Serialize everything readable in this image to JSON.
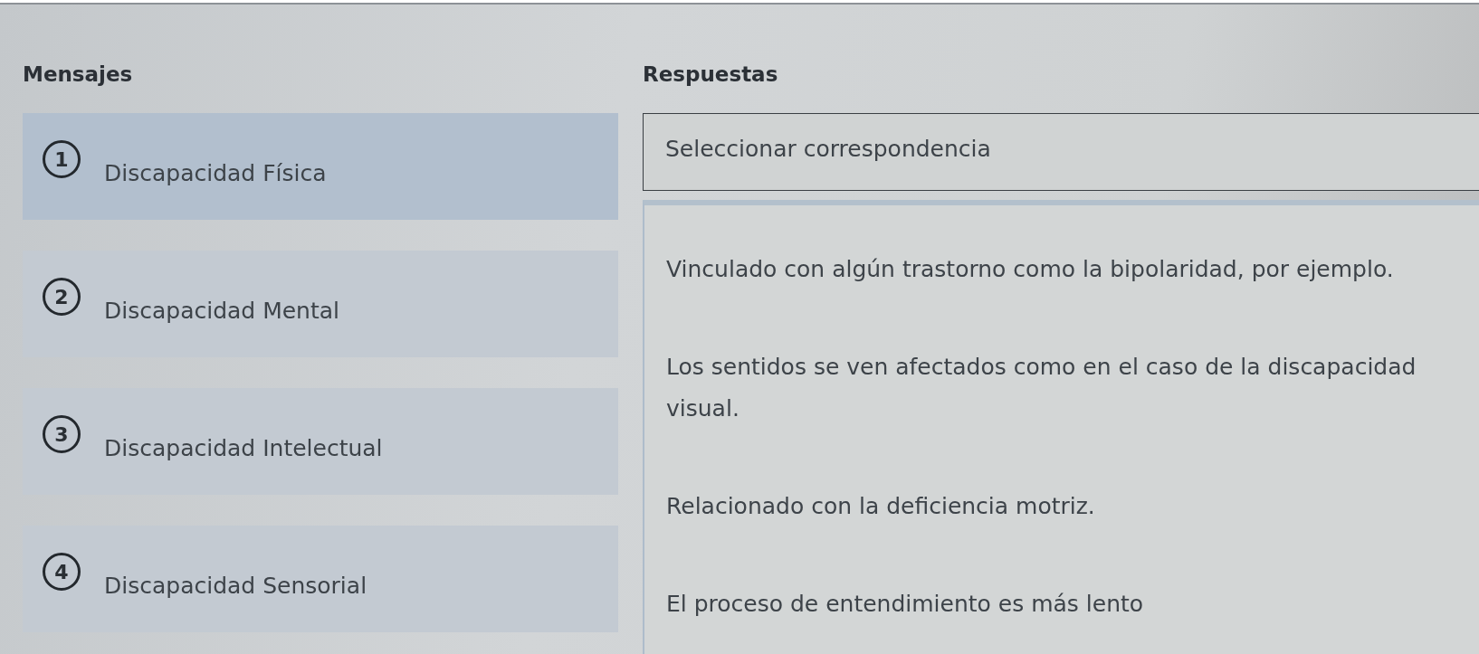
{
  "messages": {
    "title": "Mensajes",
    "items": [
      {
        "number": "1",
        "label": "Discapacidad Física",
        "selected": true
      },
      {
        "number": "2",
        "label": "Discapacidad Mental",
        "selected": false
      },
      {
        "number": "3",
        "label": "Discapacidad Intelectual",
        "selected": false
      },
      {
        "number": "4",
        "label": "Discapacidad Sensorial",
        "selected": false
      }
    ]
  },
  "responses": {
    "title": "Respuestas",
    "select": {
      "placeholder": "Seleccionar correspondencia"
    },
    "options": [
      "Vinculado con algún trastorno como la bipolaridad, por ejemplo.",
      "Los sentidos se ven afectados como en el caso de la discapacidad visual.",
      "Relacionado con la deficiencia motriz.",
      "El proceso de entendimiento es más lento"
    ]
  }
}
